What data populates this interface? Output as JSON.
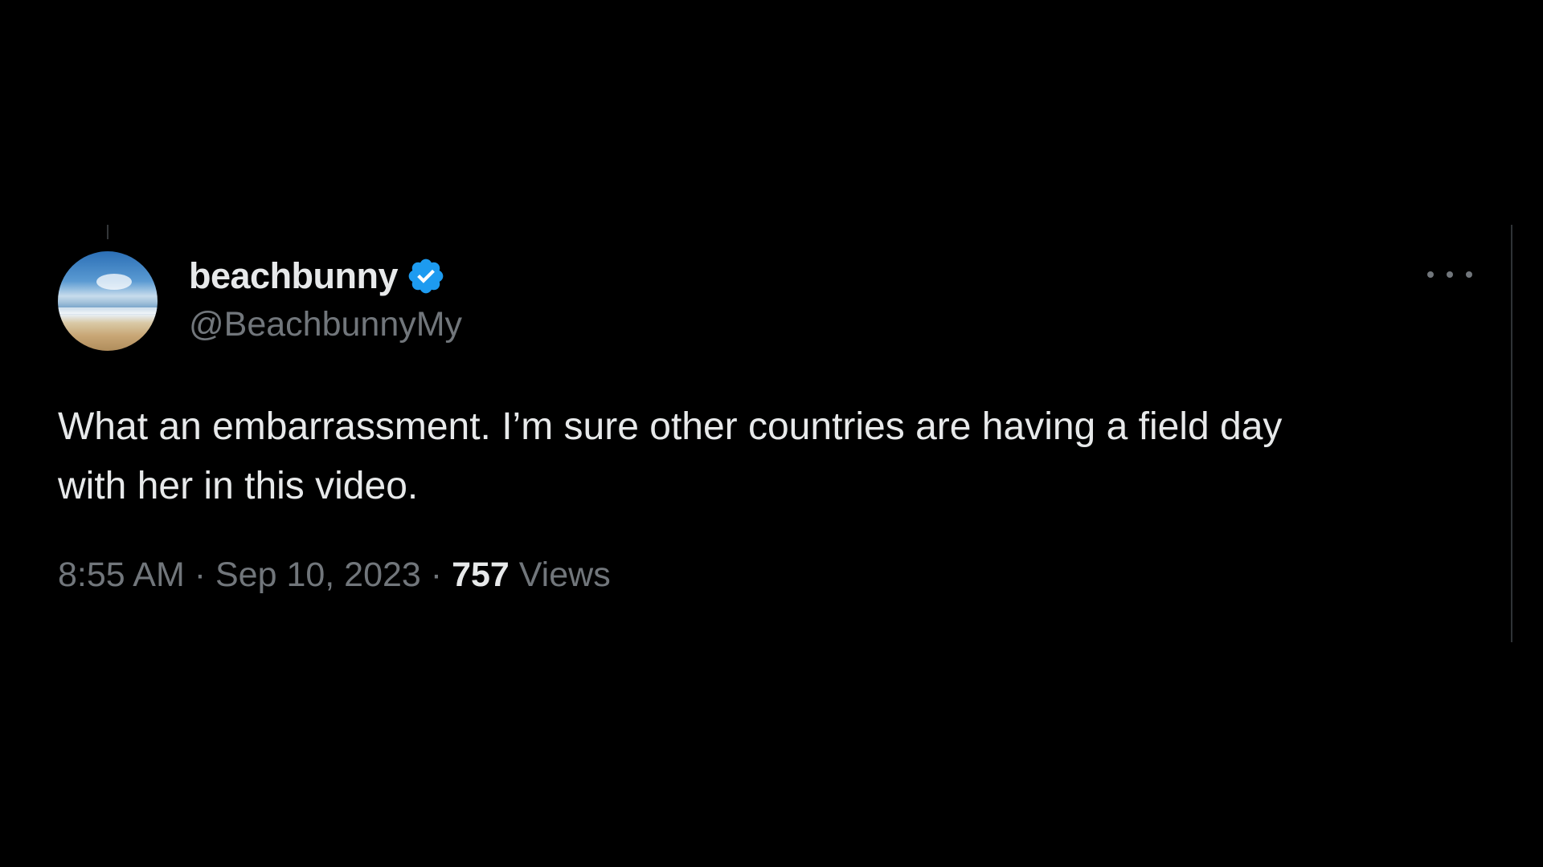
{
  "tweet": {
    "author": {
      "display_name": "beachbunny",
      "handle": "@BeachbunnyMy",
      "verified": true,
      "avatar_icon": "beach-avatar",
      "verified_icon": "verified-badge-icon"
    },
    "text_line1": "What an embarrassment. I’m sure other countries are having a field day",
    "text_line2": "with her in this video.",
    "time": "8:55 AM",
    "separator": "·",
    "date": "Sep 10, 2023",
    "views_count": "757",
    "views_label": "Views",
    "more_icon": "more-options-icon"
  },
  "colors": {
    "background": "#000000",
    "text_primary": "#e7e9ea",
    "text_secondary": "#71767b",
    "verified_blue": "#1d9bf0",
    "border": "#2f3336"
  }
}
